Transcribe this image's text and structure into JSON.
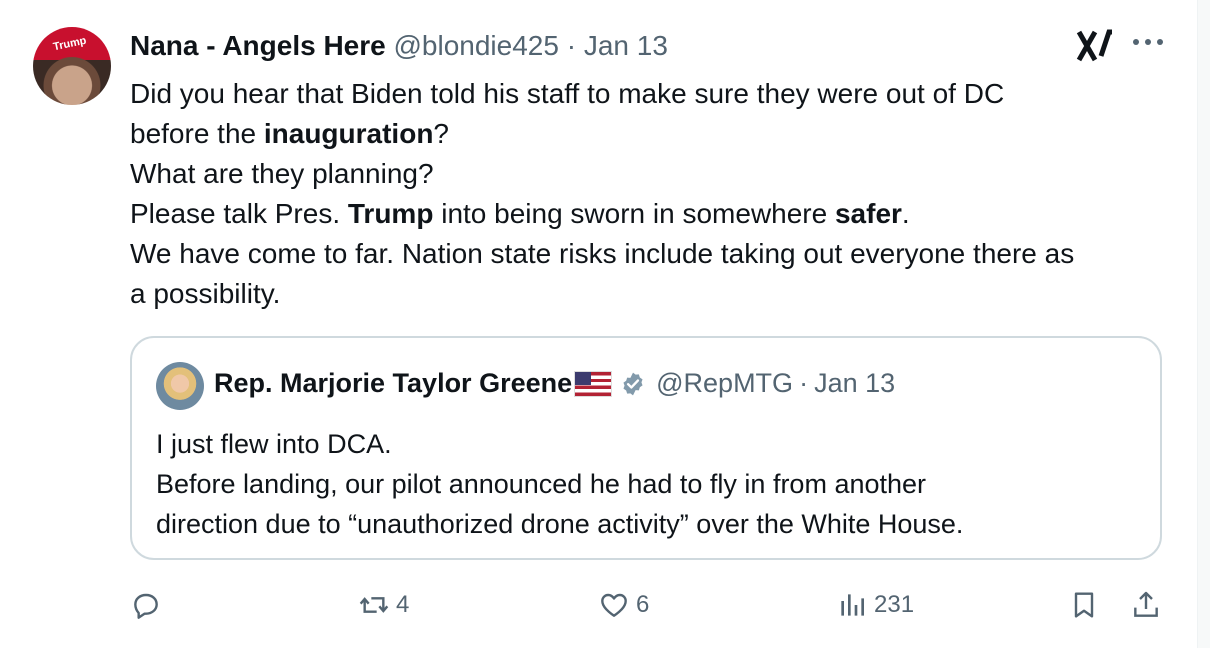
{
  "tweet": {
    "author_name": "Nana - Angels Here",
    "handle": "@blondie425",
    "separator": "·",
    "date": "Jan 13",
    "avatar_cap_text": "Trump",
    "lines": [
      {
        "parts": [
          {
            "t": "Did you hear that Biden told his staff to make sure they were out of DC",
            "b": false
          }
        ]
      },
      {
        "parts": [
          {
            "t": "before the ",
            "b": false
          },
          {
            "t": "inauguration",
            "b": true
          },
          {
            "t": "?",
            "b": false
          }
        ]
      },
      {
        "parts": [
          {
            "t": "What are they planning?",
            "b": false
          }
        ]
      },
      {
        "parts": [
          {
            "t": "Please talk Pres. ",
            "b": false
          },
          {
            "t": "Trump",
            "b": true
          },
          {
            "t": " into being sworn in somewhere ",
            "b": false
          },
          {
            "t": "safer",
            "b": true
          },
          {
            "t": ".",
            "b": false
          }
        ]
      },
      {
        "parts": [
          {
            "t": "We have come to far. Nation state risks include taking out everyone there as",
            "b": false
          }
        ]
      },
      {
        "parts": [
          {
            "t": "a possibility.",
            "b": false
          }
        ]
      }
    ]
  },
  "quote": {
    "author_name": "Rep. Marjorie Taylor Greene",
    "flag_icon": "us-flag-icon",
    "verified_icon": "verified-badge-icon",
    "handle": "@RepMTG",
    "separator": "·",
    "date": "Jan 13",
    "lines": [
      "I just flew into DCA.",
      "Before landing, our pilot announced he had to fly in from another",
      "direction due to “unauthorized drone activity” over the White House."
    ]
  },
  "actions": {
    "reply": {
      "icon": "reply-icon",
      "count": ""
    },
    "retweet": {
      "icon": "retweet-icon",
      "count": "4"
    },
    "like": {
      "icon": "heart-icon",
      "count": "6"
    },
    "views": {
      "icon": "views-icon",
      "count": "231"
    },
    "bookmark": {
      "icon": "bookmark-icon"
    },
    "share": {
      "icon": "share-icon"
    }
  },
  "colors": {
    "text": "#0f1419",
    "muted": "#536471",
    "border": "#cfd9de",
    "verified": "#829aab"
  }
}
